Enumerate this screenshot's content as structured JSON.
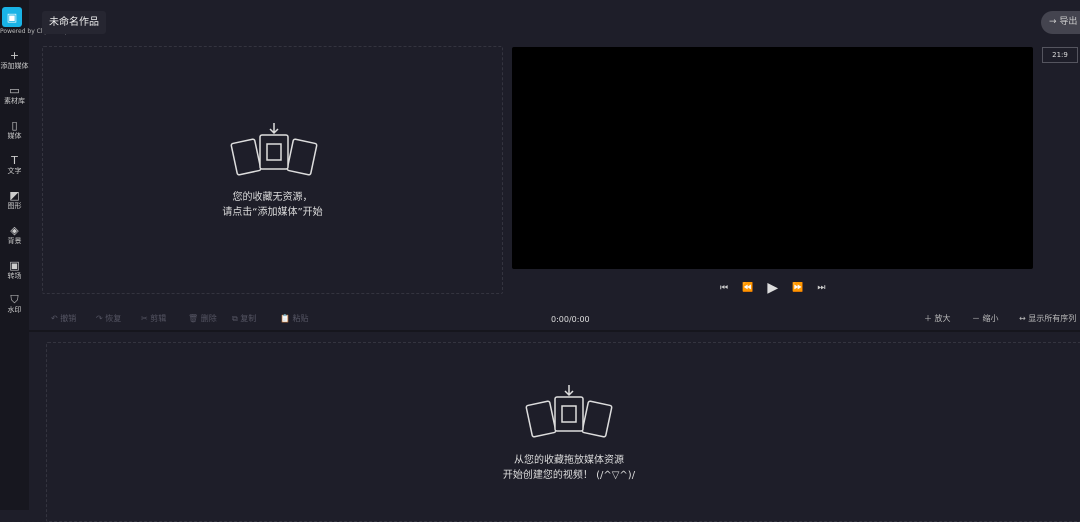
{
  "sidebar": {
    "logo_icon": "bot-icon",
    "powered": "Powered by Clipchamp",
    "items": [
      {
        "label": "添加媒体",
        "icon": "+"
      },
      {
        "label": "素材库",
        "icon": "▭"
      },
      {
        "label": "媒体",
        "icon": "▯"
      },
      {
        "label": "文字",
        "icon": "T"
      },
      {
        "label": "图形",
        "icon": "◩"
      },
      {
        "label": "背景",
        "icon": "◈"
      },
      {
        "label": "转场",
        "icon": "▣"
      },
      {
        "label": "水印",
        "icon": "⛉"
      }
    ]
  },
  "header": {
    "title": "未命名作品",
    "export": "导出",
    "ratio": "21:9"
  },
  "library": {
    "line1": "您的收藏无资源，",
    "line2": "请点击“添加媒体”开始"
  },
  "toolbar": {
    "undo": "撤销",
    "redo": "恢复",
    "cut": "剪辑",
    "delete": "删除",
    "copy": "复制",
    "paste": "粘贴",
    "time": "0:00/0:00",
    "zoom_in": "放大",
    "zoom_out": "缩小",
    "show_all": "显示所有序列"
  },
  "timeline": {
    "line1": "从您的收藏拖放媒体资源",
    "line2": "开始创建您的视频！ (/^▽^)/"
  }
}
